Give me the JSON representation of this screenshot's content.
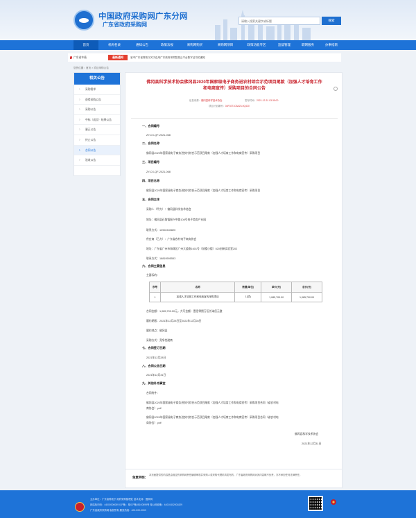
{
  "header": {
    "title": "中国政府采购网广东分网",
    "subtitle": "广东省政府采购网",
    "search_placeholder": "请输入搜索关键字或标题",
    "search_button": "搜索"
  },
  "nav": {
    "items": [
      {
        "label": "首页"
      },
      {
        "label": "机构名录"
      },
      {
        "label": "通知公告"
      },
      {
        "label": "政策法规"
      },
      {
        "label": "采购网购买"
      },
      {
        "label": "采购网项目"
      },
      {
        "label": "政策功能专区"
      },
      {
        "label": "监督管理"
      },
      {
        "label": "职网服务"
      },
      {
        "label": "办事指南"
      }
    ]
  },
  "notice": {
    "location": "广东省本级",
    "badge": "最新通知",
    "text": "省市广东省财政厅关于启用广东政府采购智慧云平台数字证书的通知"
  },
  "breadcrumb": "您的位置：首页 > 项目采购公告",
  "sidebar": {
    "title": "相关公告",
    "items": [
      {
        "label": "采购需求"
      },
      {
        "label": "获得采购公告"
      },
      {
        "label": "采购公告"
      },
      {
        "label": "中标（成交）结果公告"
      },
      {
        "label": "更正公告"
      },
      {
        "label": "终止公告"
      },
      {
        "label": "合同公告"
      },
      {
        "label": "验收公告"
      }
    ]
  },
  "article": {
    "title_line1": "佛冈县科学技术协会佛冈县2020年国家级电子商务进农村综合示范项目尾款（加强人才培育工作",
    "title_line2": "和电商宣传）采购项目的合同公告",
    "meta_src_label": "信息来源：",
    "meta_src": "佛冈县科学技术协会",
    "meta_date_label": "发布时间：",
    "meta_date": "2021-12-31 03:35:00",
    "meta_code_label": "项目计划编号：",
    "meta_code": "04F0271C8A23-0Q420",
    "sections": [
      {
        "heading": "一、合同编号",
        "lines": [
          "ZY-CX-QF-2021-068"
        ]
      },
      {
        "heading": "二、合同名称",
        "lines": [
          "佛冈县2020年国家级电子商务进农村综合示范项目尾款（加强人才培育工作和电商宣传）采购项目"
        ]
      },
      {
        "heading": "三、项目编号",
        "lines": [
          "ZY-CX-QF-2021-068"
        ]
      },
      {
        "heading": "四、项目名称",
        "lines": [
          "佛冈县2020年国家级电子商务进农村综合示范项目尾款（加强人才培育工作和电商宣传）采购项目"
        ]
      },
      {
        "heading": "五、合同主体",
        "lines": [
          "采购人（甲方）：佛冈县科学技术协会",
          "地址：佛冈县石角镇振兴中路108号电子商务产业园",
          "联系方式：13922440820",
          "供应商（乙方）：广东省农村电子商务协会",
          "地址：广东省广州市海珠区广州大道南1601号（前楼小楼）020创新实验室202",
          "联系方式：18819595553"
        ]
      },
      {
        "heading": "六、合同主要信息",
        "lines": [
          "主要标的："
        ]
      }
    ],
    "table": {
      "headers": [
        "序号",
        "名称",
        "数量(单位)",
        "单价(元)",
        "总价(元)"
      ],
      "rows": [
        [
          "1",
          "加强人才培育工作和电商宣传采购项目",
          "1(项)",
          "1,085,700.00",
          "1,085,700.00"
        ]
      ]
    },
    "after_table": [
      "合同金额：1,085,700.00元，大写金额：壹佰零捌万伍仟柒佰元整",
      "履约期限：2021年12月28日至2022年12月28日",
      "履约地点：佛冈县",
      "采购方式：竞争性磋商"
    ],
    "sections2": [
      {
        "heading": "七、合同签订日期",
        "lines": [
          "2021年12月28日"
        ]
      },
      {
        "heading": "八、合同公告日期",
        "lines": [
          "2021年12月31日"
        ]
      },
      {
        "heading": "九、其他补充事宜",
        "lines": [
          "合同附件：",
          "佛冈县2020年国家级电子商务进农村综合示范项目尾款（加强人才培育工作和电商宣传）采购项目合同（省农村电",
          "商协会）.pdf",
          "佛冈县2020年国家级电子商务进农村综合示范项目尾款（加强人才培育工作和电商宣传）采购项目合同（省农村电",
          "商协会）.pdf"
        ]
      }
    ],
    "sign_org": "佛冈县科学技术协会",
    "sign_date": "2021年12月31日"
  },
  "disclaimer": {
    "label": "免责声明：",
    "text": "本页面提供的内容是由相应的采购网责任编辑审核并采购人或采购代理机构发布的，广东省政府采购网对其内容概不负责，亦不承担任何法律责任。"
  },
  "footer": {
    "line1": "主办单位：广东省财政厅   政府采购管理处   技术支持：国采网",
    "line2": "网站标识码：44000000089   ICP备：粤ICP备08100899号   粤公网安备：44010402001829",
    "line3": "广东省政府采购网 版权所有   服务热线：400-000-0000"
  }
}
